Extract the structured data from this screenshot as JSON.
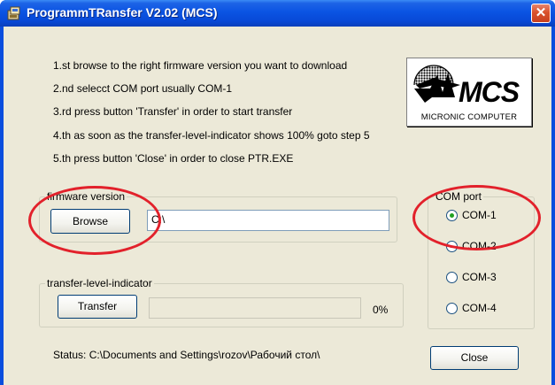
{
  "window": {
    "title": "ProgrammTRansfer V2.02 (MCS)",
    "close_glyph": "✕"
  },
  "instructions": [
    "1.st browse to the right firmware version you want to download",
    "2.nd selecct COM port usually COM-1",
    "3.rd press button  'Transfer' in order to start transfer",
    "4.th as soon as the transfer-level-indicator shows 100% goto step 5",
    "5.th press button 'Close' in order to close PTR.EXE"
  ],
  "logo": {
    "mark": "MCS",
    "subtitle": "MICRONIC COMPUTER"
  },
  "firmware": {
    "group_label": "firmware version",
    "browse_label": "Browse",
    "path_value": "C:\\"
  },
  "transfer": {
    "group_label": "transfer-level-indicator",
    "button_label": "Transfer",
    "percent_text": "0%",
    "progress_fraction": 0
  },
  "com_port": {
    "group_label": "COM port",
    "options": [
      "COM-1",
      "COM-2",
      "COM-3",
      "COM-4"
    ],
    "selected": "COM-1"
  },
  "status": {
    "text": "Status: C:\\Documents and Settings\\rozov\\Рабочий стол\\"
  },
  "close_button": {
    "label": "Close"
  },
  "colors": {
    "title_bar": "#0a54e3",
    "dialog_bg": "#ece9d8",
    "annotation": "#e2212b",
    "close_button": "#d9512c"
  },
  "icons": [
    "app-icon",
    "close-icon"
  ]
}
